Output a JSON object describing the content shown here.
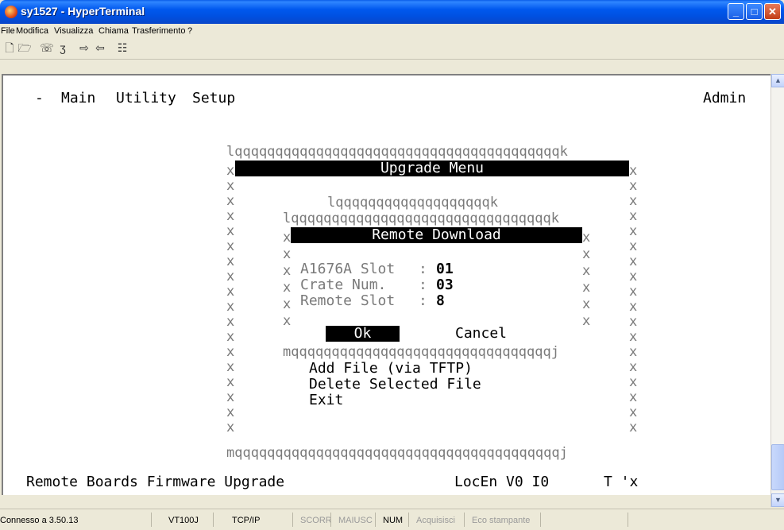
{
  "window": {
    "title": "sy1527 - HyperTerminal"
  },
  "menu": [
    "File",
    "Modifica",
    "Visualizza",
    "Chiama",
    "Trasferimento",
    "?"
  ],
  "toolbar": {
    "icons": [
      "new-icon",
      "open-icon",
      "phone-icon",
      "disconnect-icon",
      "send-icon",
      "receive-icon",
      "properties-icon"
    ]
  },
  "terminal": {
    "header": {
      "dash": "-",
      "main": "Main",
      "utility": "Utility",
      "setup": "Setup",
      "user": "Admin"
    },
    "outer_box": {
      "top": "lqqqqqqqqqqqqqqqqqqqqqqqqqqqqqqqqqqqqqqqqk",
      "bottom": "mqqqqqqqqqqqqqqqqqqqqqqqqqqqqqqqqqqqqqqqqj",
      "side": "x",
      "title": "Upgrade Menu"
    },
    "inner_box": {
      "top_small": "lqqqqqqqqqqqqqqqqqqqk",
      "top": "lqqqqqqqqqqqqqqqqqqqqqqqqqqqqqqqqk",
      "bottom": "mqqqqqqqqqqqqqqqqqqqqqqqqqqqqqqqqj",
      "title": "Remote Download",
      "fields": [
        {
          "label": "A1676A Slot",
          "sep": ":",
          "value": "01"
        },
        {
          "label": "Crate Num.",
          "sep": ":",
          "value": "03"
        },
        {
          "label": "Remote Slot",
          "sep": ":",
          "value": "8"
        }
      ],
      "ok": "Ok",
      "cancel": "Cancel"
    },
    "menu_items": [
      "Add File (via TFTP)",
      "Delete Selected File",
      "Exit"
    ],
    "bottom_left": "Remote Boards Firmware Upgrade",
    "bottom_status": "LocEn V0 I0",
    "bottom_right": "T 'x"
  },
  "status": {
    "connected": "Connesso a 3.50.13",
    "emulation": "VT100J",
    "protocol": "TCP/IP",
    "scroll": "SCORR",
    "caps": "MAIUSC",
    "num": "NUM",
    "capture": "Acquisisci",
    "print": "Eco stampante"
  }
}
